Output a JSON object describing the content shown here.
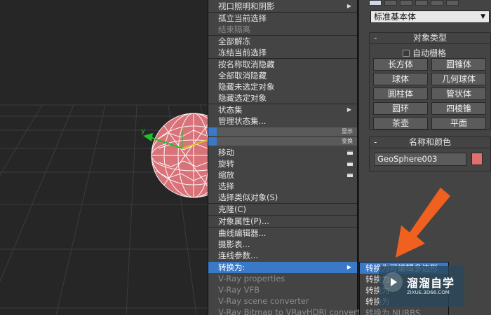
{
  "viewport": {
    "axis_label": "y",
    "object_color": "#d9737a"
  },
  "quad_menu": {
    "items": [
      {
        "label": "视口照明和阴影",
        "disabled": false,
        "submenu": true
      },
      {
        "label": "孤立当前选择",
        "disabled": false
      },
      {
        "label": "结束隔离",
        "disabled": true
      },
      {
        "label": "全部解冻",
        "disabled": false
      },
      {
        "label": "冻结当前选择",
        "disabled": false
      },
      {
        "label": "按名称取消隐藏",
        "disabled": false
      },
      {
        "label": "全部取消隐藏",
        "disabled": false
      },
      {
        "label": "隐藏未选定对象",
        "disabled": false
      },
      {
        "label": "隐藏选定对象",
        "disabled": false
      },
      {
        "label": "状态集",
        "disabled": false,
        "submenu": true
      },
      {
        "label": "管理状态集...",
        "disabled": false
      }
    ],
    "band_display": "显示",
    "band_transform": "变换",
    "transform_items": [
      {
        "label": "移动",
        "disabled": false
      },
      {
        "label": "旋转",
        "disabled": false
      },
      {
        "label": "缩放",
        "disabled": false
      },
      {
        "label": "选择",
        "disabled": false
      },
      {
        "label": "选择类似对象(S)",
        "disabled": false
      }
    ],
    "clone": "克隆(C)",
    "object_properties": "对象属性(P)...",
    "curve_editor": "曲线编辑器...",
    "dope_sheet": "摄影表...",
    "wire_parameters": "连线参数...",
    "convert_to": "转换为:",
    "vray_items": [
      "V-Ray properties",
      "V-Ray VFB",
      "V-Ray scene converter",
      "V-Ray Bitmap to VRayHDRI converter"
    ]
  },
  "submenu": {
    "items": [
      {
        "label": "转换为可编辑多边形",
        "state": "selected"
      },
      {
        "label": "转换为可编辑网格",
        "state": "normal"
      },
      {
        "label": "转换为可编辑面片",
        "state": "normal"
      },
      {
        "label": "转换为可编辑样条线",
        "state": "normal"
      },
      {
        "label": "转换为 NURBS",
        "state": "disabled"
      }
    ],
    "visible_labels": [
      "转换为可编辑多边形",
      "转换为",
      "转换为",
      "转换为",
      "转换为 NURBS"
    ]
  },
  "command_panel": {
    "dropdown_value": "标准基本体",
    "object_type_title": "对象类型",
    "autogrid_label": "自动栅格",
    "primitives": [
      "长方体",
      "圆锥体",
      "球体",
      "几何球体",
      "圆柱体",
      "管状体",
      "圆环",
      "四棱锥",
      "茶壶",
      "平面"
    ],
    "name_color_title": "名称和颜色",
    "object_name": "GeoSphere003",
    "object_color": "#e07070",
    "collapse_symbol": "-"
  },
  "watermark": {
    "name": "溜溜自学",
    "url": "ZIXUE.3D66.COM"
  },
  "colors": {
    "highlight": "#3a78c8",
    "annotation_arrow": "#f0601e"
  }
}
